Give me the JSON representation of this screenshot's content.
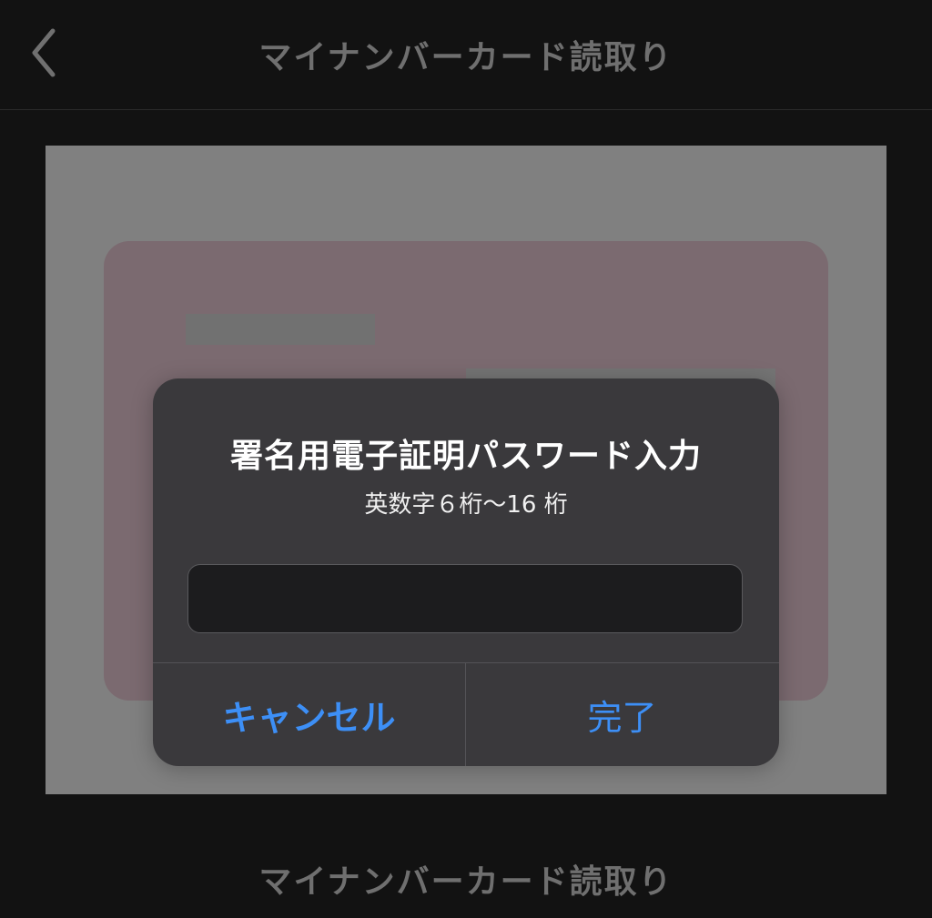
{
  "nav": {
    "title": "マイナンバーカード読取り",
    "back_icon": "chevron-left-icon"
  },
  "bottom": {
    "label": "マイナンバーカード読取り"
  },
  "alert": {
    "title": "署名用電子証明パスワード入力",
    "message": "英数字６桁〜16 桁",
    "input_value": "",
    "cancel_label": "キャンセル",
    "done_label": "完了"
  },
  "colors": {
    "background": "#121212",
    "accent": "#3d8ff6",
    "alert_bg": "#3a393c",
    "card": "#7b6a70",
    "panel": "#808080"
  }
}
